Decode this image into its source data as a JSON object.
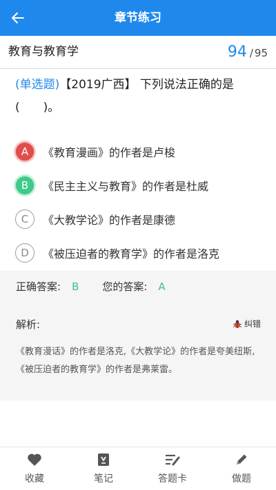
{
  "header": {
    "title": "章节练习"
  },
  "subheader": {
    "section": "教育与教育学",
    "current": "94",
    "separator": "/",
    "total": "95"
  },
  "question": {
    "type": "(单选题)",
    "stem": "【2019广西】 下列说法正确的是",
    "blank": "(　　)。"
  },
  "options": [
    {
      "letter": "A",
      "text": "《教育漫画》的作者是卢梭",
      "state": "wrong"
    },
    {
      "letter": "B",
      "text": "《民主主义与教育》的作者是杜威",
      "state": "correct"
    },
    {
      "letter": "C",
      "text": "《大教学论》的作者是康德",
      "state": "normal"
    },
    {
      "letter": "D",
      "text": "《被压迫者的教育学》的作者是洛克",
      "state": "normal"
    }
  ],
  "answers": {
    "correct_label": "正确答案:",
    "correct_value": "B",
    "yours_label": "您的答案:",
    "yours_value": "A"
  },
  "analysis": {
    "label": "解析:",
    "report_label": "纠错",
    "text": "《教育漫话》的作者是洛克,《大教学论》的作者是夸美纽斯,《被压迫者的教育学》的作者是弗莱雷。"
  },
  "bottom_nav": [
    {
      "label": "收藏",
      "icon": "heart-icon"
    },
    {
      "label": "笔记",
      "icon": "notebook-icon"
    },
    {
      "label": "答题卡",
      "icon": "answer-card-icon"
    },
    {
      "label": "做题",
      "icon": "pencil-icon"
    }
  ],
  "colors": {
    "primary": "#1f88ec",
    "wrong": "#e04e4b",
    "correct": "#3fc98b",
    "panel": "#f5f5f5"
  }
}
